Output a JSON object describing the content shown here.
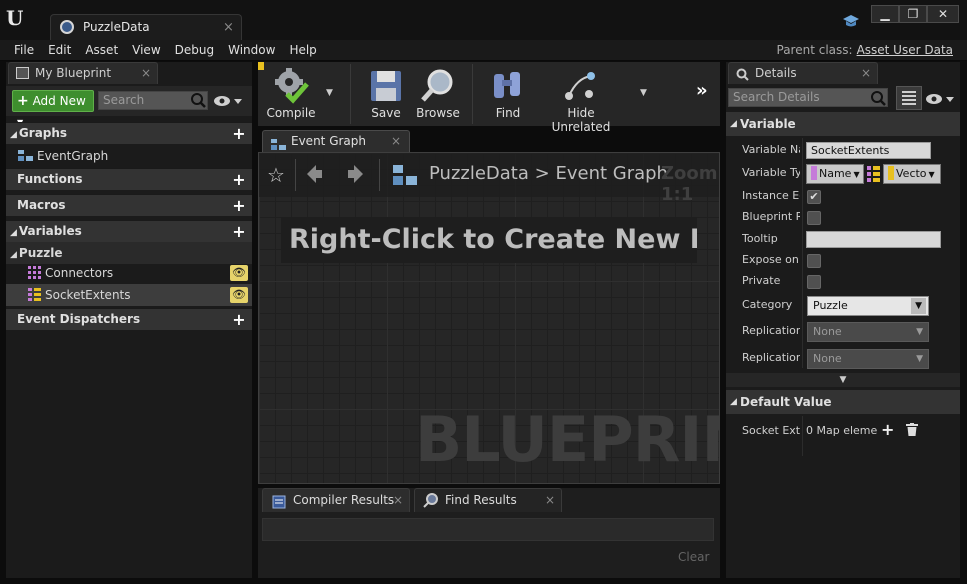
{
  "window": {
    "tab_title": "PuzzleData",
    "tab_close": "×",
    "btn_min": "▁",
    "btn_max": "❐",
    "btn_close": "✕"
  },
  "menu": {
    "items": [
      "File",
      "Edit",
      "Asset",
      "View",
      "Debug",
      "Window",
      "Help"
    ],
    "parent_class_label": "Parent class:",
    "parent_class_value": "Asset User Data"
  },
  "my_blueprint": {
    "tab_label": "My Blueprint",
    "add_new_label": "Add New",
    "search_placeholder": "Search",
    "sections": {
      "graphs": "Graphs",
      "event_graph_item": "EventGraph",
      "functions": "Functions",
      "macros": "Macros",
      "variables": "Variables",
      "puzzle_category": "Puzzle",
      "var_connectors": "Connectors",
      "var_socket_extents": "SocketExtents",
      "event_dispatchers": "Event Dispatchers"
    }
  },
  "toolbar": {
    "compile": "Compile",
    "save": "Save",
    "browse": "Browse",
    "find": "Find",
    "hide_unrelated": "Hide Unrelated"
  },
  "graph": {
    "tab_label": "Event Graph",
    "breadcrumb_root": "PuzzleData",
    "breadcrumb_sep": ">",
    "breadcrumb_leaf": "Event Graph",
    "zoom_label": "Zoom 1:1",
    "hint": "Right-Click to Create New Node",
    "watermark": "BLUEPRINT"
  },
  "bottom": {
    "tab_compiler": "Compiler Results",
    "tab_find": "Find Results",
    "clear": "Clear"
  },
  "details": {
    "tab_label": "Details",
    "search_placeholder": "Search Details",
    "variable_section": "Variable",
    "props": {
      "variable_name_label": "Variable Na",
      "variable_name_value": "SocketExtents",
      "variable_type_label": "Variable Ty",
      "type_key": "Name",
      "type_value": "Vecto",
      "instance_editable_label": "Instance Ed",
      "blueprint_readonly_label": "Blueprint Re",
      "tooltip_label": "Tooltip",
      "expose_label": "Expose on S",
      "private_label": "Private",
      "category_label": "Category",
      "category_value": "Puzzle",
      "replication_label": "Replication",
      "replication_value": "None",
      "replication2_label": "Replication",
      "replication2_value": "None"
    },
    "default_value_section": "Default Value",
    "default_prop_label": "Socket Exte",
    "default_prop_value": "0 Map eleme"
  },
  "colors": {
    "accent_green": "#3e8e2e",
    "eye_badge": "#e6d36a",
    "name_pin": "#c57bd9",
    "vector_pin": "#e8c020"
  }
}
